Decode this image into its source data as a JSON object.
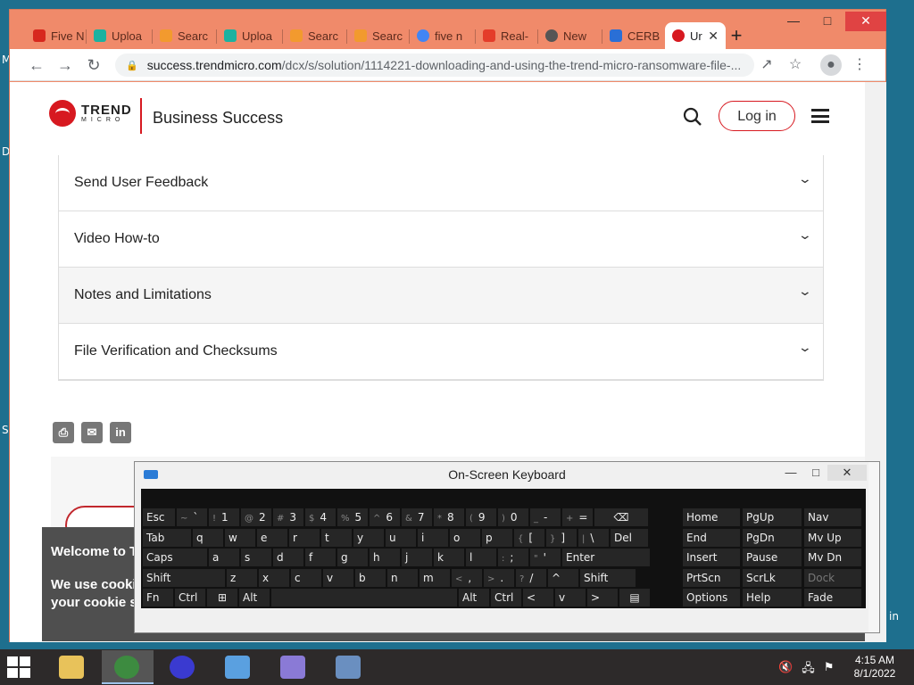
{
  "desktop": {
    "edge_letters": [
      "M",
      "D",
      "S"
    ],
    "right_fragment": "in"
  },
  "browser": {
    "tabs": [
      {
        "label": "Five N",
        "icon": "acrobat-icon",
        "color": "#d7281e"
      },
      {
        "label": "Uploa",
        "icon": "upload-cloud-icon",
        "color": "#1bb2a0"
      },
      {
        "label": "Searc",
        "icon": "location-pin-icon",
        "color": "#f29a2e"
      },
      {
        "label": "Uploa",
        "icon": "upload-cloud-icon",
        "color": "#1bb2a0"
      },
      {
        "label": "Searc",
        "icon": "location-pin-icon",
        "color": "#f29a2e"
      },
      {
        "label": "Searc",
        "icon": "location-pin-icon",
        "color": "#f29a2e"
      },
      {
        "label": "five n",
        "icon": "google-icon",
        "color": "#4285f4"
      },
      {
        "label": "Real-",
        "icon": "warning-triangle-icon",
        "color": "#e43d2a"
      },
      {
        "label": "New",
        "icon": "chrome-icon",
        "color": "#555555"
      },
      {
        "label": "CERB",
        "icon": "document-icon",
        "color": "#2a6fd6"
      },
      {
        "label": "Ur",
        "icon": "trend-micro-icon",
        "color": "#d71920",
        "active": true
      }
    ],
    "new_tab_label": "+",
    "url_host": "success.trendmicro.com",
    "url_path": "/dcx/s/solution/1114221-downloading-and-using-the-trend-micro-ransomware-file-..."
  },
  "site": {
    "logo_word1": "TREND",
    "logo_word2": "MICRO",
    "title": "Business Success",
    "login_label": "Log in",
    "accordion": [
      {
        "label": "Send User Feedback"
      },
      {
        "label": "Video How-to"
      },
      {
        "label": "Notes and Limitations"
      },
      {
        "label": "File Verification and Checksums"
      }
    ],
    "share": [
      "print-icon",
      "email-icon",
      "linkedin-icon"
    ],
    "share_linkedin_label": "in",
    "cookie_title": "Welcome to T",
    "cookie_text": "We use cooki Cookie Notice your cookie s"
  },
  "osk": {
    "title": "On-Screen Keyboard",
    "rows": [
      [
        {
          "l": "Esc",
          "w": 38
        },
        {
          "s": "~",
          "l": "`",
          "w": 36
        },
        {
          "s": "!",
          "l": "1",
          "w": 36
        },
        {
          "s": "@",
          "l": "2",
          "w": 36
        },
        {
          "s": "#",
          "l": "3",
          "w": 36
        },
        {
          "s": "$",
          "l": "4",
          "w": 36
        },
        {
          "s": "%",
          "l": "5",
          "w": 36
        },
        {
          "s": "^",
          "l": "6",
          "w": 36
        },
        {
          "s": "&",
          "l": "7",
          "w": 36
        },
        {
          "s": "*",
          "l": "8",
          "w": 36
        },
        {
          "s": "(",
          "l": "9",
          "w": 36
        },
        {
          "s": ")",
          "l": "0",
          "w": 36
        },
        {
          "s": "_",
          "l": "-",
          "w": 36
        },
        {
          "s": "+",
          "l": "=",
          "w": 36
        },
        {
          "l": "⌫",
          "w": 62,
          "c": true
        }
      ],
      [
        {
          "l": "Tab",
          "w": 56
        },
        {
          "l": "q",
          "w": 36
        },
        {
          "l": "w",
          "w": 36
        },
        {
          "l": "e",
          "w": 36
        },
        {
          "l": "r",
          "w": 36
        },
        {
          "l": "t",
          "w": 36
        },
        {
          "l": "y",
          "w": 36
        },
        {
          "l": "u",
          "w": 36
        },
        {
          "l": "i",
          "w": 36
        },
        {
          "l": "o",
          "w": 36
        },
        {
          "l": "p",
          "w": 36
        },
        {
          "s": "{",
          "l": "[",
          "w": 36
        },
        {
          "s": "}",
          "l": "]",
          "w": 36
        },
        {
          "s": "|",
          "l": "\\",
          "w": 36
        },
        {
          "l": "Del",
          "w": 44
        }
      ],
      [
        {
          "l": "Caps",
          "w": 74
        },
        {
          "l": "a",
          "w": 36
        },
        {
          "l": "s",
          "w": 36
        },
        {
          "l": "d",
          "w": 36
        },
        {
          "l": "f",
          "w": 36
        },
        {
          "l": "g",
          "w": 36
        },
        {
          "l": "h",
          "w": 36
        },
        {
          "l": "j",
          "w": 36
        },
        {
          "l": "k",
          "w": 36
        },
        {
          "l": "l",
          "w": 36
        },
        {
          "s": ":",
          "l": ";",
          "w": 36
        },
        {
          "s": "\"",
          "l": "'",
          "w": 36
        },
        {
          "l": "Enter",
          "w": 100
        }
      ],
      [
        {
          "l": "Shift",
          "w": 94
        },
        {
          "l": "z",
          "w": 36
        },
        {
          "l": "x",
          "w": 36
        },
        {
          "l": "c",
          "w": 36
        },
        {
          "l": "v",
          "w": 36
        },
        {
          "l": "b",
          "w": 36
        },
        {
          "l": "n",
          "w": 36
        },
        {
          "l": "m",
          "w": 36
        },
        {
          "s": "<",
          "l": ",",
          "w": 36
        },
        {
          "s": ">",
          "l": ".",
          "w": 36
        },
        {
          "s": "?",
          "l": "/",
          "w": 36
        },
        {
          "l": "^",
          "w": 36
        },
        {
          "l": "Shift",
          "w": 64
        }
      ],
      [
        {
          "l": "Fn",
          "w": 36
        },
        {
          "l": "Ctrl",
          "w": 36
        },
        {
          "l": "⊞",
          "w": 36,
          "c": true
        },
        {
          "l": "Alt",
          "w": 36
        },
        {
          "l": "",
          "w": 210
        },
        {
          "l": "Alt",
          "w": 36
        },
        {
          "l": "Ctrl",
          "w": 36
        },
        {
          "l": "<",
          "w": 36
        },
        {
          "l": "v",
          "w": 36
        },
        {
          "l": ">",
          "w": 36
        },
        {
          "l": "▤",
          "w": 36,
          "c": true
        }
      ]
    ],
    "nav_keys": [
      [
        "Home",
        "PgUp",
        "Nav"
      ],
      [
        "End",
        "PgDn",
        "Mv Up"
      ],
      [
        "Insert",
        "Pause",
        "Mv Dn"
      ],
      [
        "PrtScn",
        "ScrLk",
        "Dock"
      ],
      [
        "Options",
        "Help",
        "Fade"
      ]
    ],
    "dim_keys": [
      "Dock"
    ]
  },
  "taskbar": {
    "apps": [
      {
        "name": "file-explorer-icon",
        "color": "#e8c25a"
      },
      {
        "name": "chrome-icon",
        "color": "#3d8b40",
        "active": true
      },
      {
        "name": "settings-gear-icon",
        "color": "#3a3ad0"
      },
      {
        "name": "control-panel-icon",
        "color": "#5aa0e0"
      },
      {
        "name": "media-app-icon",
        "color": "#8a7ad6"
      },
      {
        "name": "on-screen-keyboard-icon",
        "color": "#6a8fc0"
      }
    ],
    "time": "4:15 AM",
    "date": "8/1/2022"
  }
}
